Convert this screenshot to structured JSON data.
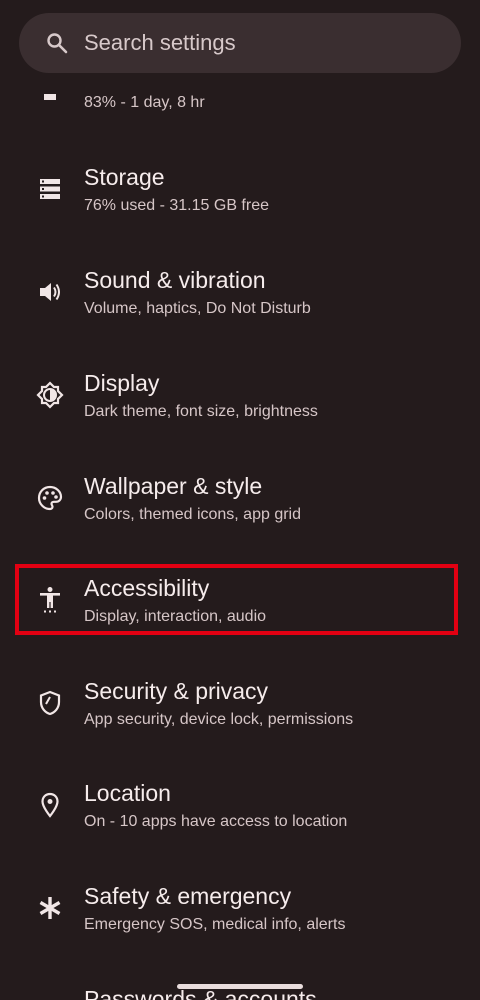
{
  "search": {
    "placeholder": "Search settings"
  },
  "items": [
    {
      "title": "",
      "subtitle": "83% - 1 day, 8 hr",
      "icon": "battery-icon"
    },
    {
      "title": "Storage",
      "subtitle": "76% used - 31.15 GB free",
      "icon": "storage-icon"
    },
    {
      "title": "Sound & vibration",
      "subtitle": "Volume, haptics, Do Not Disturb",
      "icon": "volume-icon"
    },
    {
      "title": "Display",
      "subtitle": "Dark theme, font size, brightness",
      "icon": "brightness-icon"
    },
    {
      "title": "Wallpaper & style",
      "subtitle": "Colors, themed icons, app grid",
      "icon": "palette-icon"
    },
    {
      "title": "Accessibility",
      "subtitle": "Display, interaction, audio",
      "icon": "accessibility-icon"
    },
    {
      "title": "Security & privacy",
      "subtitle": "App security, device lock, permissions",
      "icon": "shield-icon"
    },
    {
      "title": "Location",
      "subtitle": "On - 10 apps have access to location",
      "icon": "location-pin-icon"
    },
    {
      "title": "Safety & emergency",
      "subtitle": "Emergency SOS, medical info, alerts",
      "icon": "asterisk-icon"
    },
    {
      "title": "Passwords & accounts",
      "subtitle": "",
      "icon": "key-icon"
    }
  ],
  "colors": {
    "background": "#241b1c",
    "highlight": "#e20012"
  }
}
